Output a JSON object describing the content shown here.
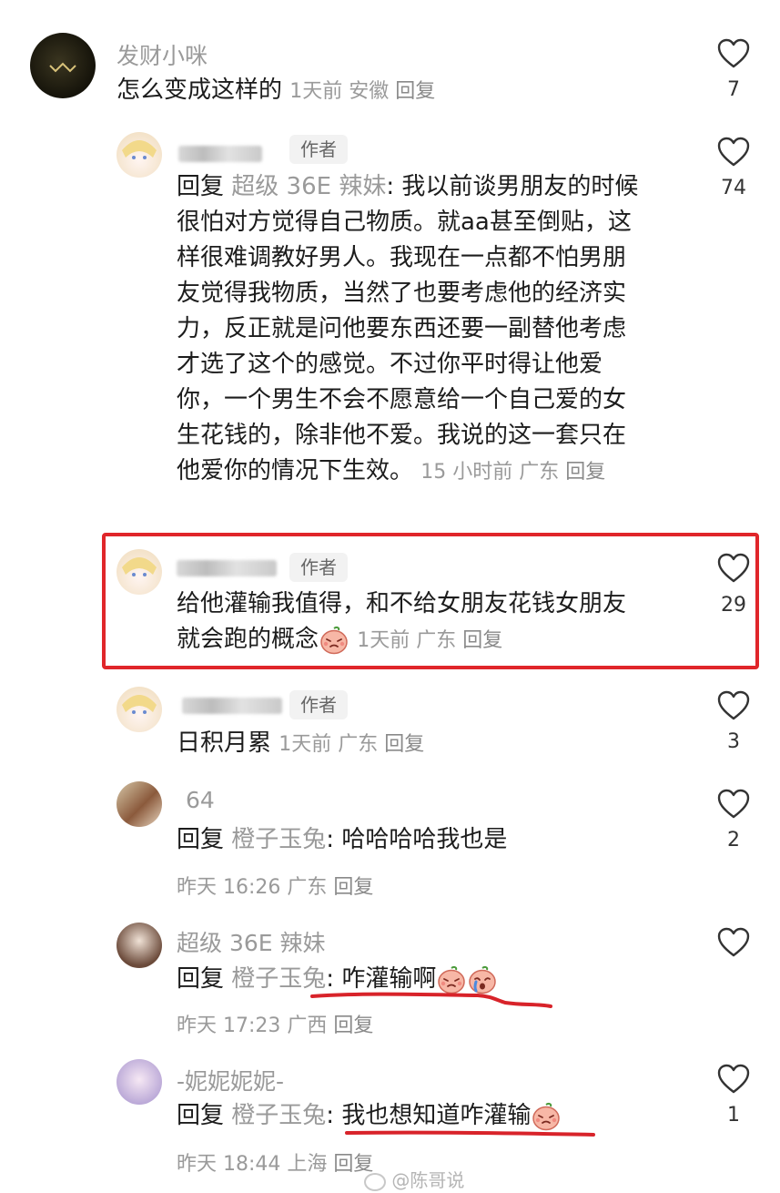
{
  "comments": [
    {
      "name": "发财小咪",
      "text": "怎么变成这样的",
      "time": "1天前",
      "location": "安徽",
      "reply_label": "回复",
      "likes": "7"
    },
    {
      "author_badge": "作者",
      "reply_prefix": "回复",
      "reply_target": "超级 36E 辣妹",
      "text_lines": [
        ": 我以前谈男朋友的时候",
        "很怕对方觉得自己物质。就aa甚至倒贴，这",
        "样很难调教好男人。我现在一点都不怕男朋",
        "友觉得我物质，当然了也要考虑他的经济实",
        "力，反正就是问他要东西还要一副替他考虑",
        "才选了这个的感觉。不过你平时得让他爱",
        "你，一个男生不会不愿意给一个自己爱的女",
        "生花钱的，除非他不爱。我说的这一套只在",
        "他爱你的情况下生效。"
      ],
      "time": "15 小时前",
      "location": "广东",
      "reply_label": "回复",
      "likes": "74"
    },
    {
      "author_badge": "作者",
      "text_lines": [
        "给他灌输我值得，和不给女朋友花钱女朋友",
        "就会跑的概念"
      ],
      "time": "1天前",
      "location": "广东",
      "reply_label": "回复",
      "likes": "29"
    },
    {
      "author_badge": "作者",
      "text": "日积月累",
      "time": "1天前",
      "location": "广东",
      "reply_label": "回复",
      "likes": "3"
    },
    {
      "name": "64",
      "reply_prefix": "回复",
      "reply_target": "橙子玉兔",
      "text": ": 哈哈哈哈我也是",
      "time": "昨天 16:26",
      "location": "广东",
      "reply_label": "回复",
      "likes": "2"
    },
    {
      "name": "超级 36E 辣妹",
      "reply_prefix": "回复",
      "reply_target": "橙子玉兔",
      "text": ": 咋灌输啊",
      "time": "昨天 17:23",
      "location": "广西",
      "reply_label": "回复",
      "likes": ""
    },
    {
      "name": "-妮妮妮妮-",
      "reply_prefix": "回复",
      "reply_target": "橙子玉兔",
      "text": ": 我也想知道咋灌输",
      "time": "昨天 18:44",
      "location": "上海",
      "reply_label": "回复",
      "likes": "1"
    }
  ],
  "watermark": "@陈哥说",
  "colors": {
    "highlight": "#e0262a",
    "underline": "#d8232a"
  }
}
